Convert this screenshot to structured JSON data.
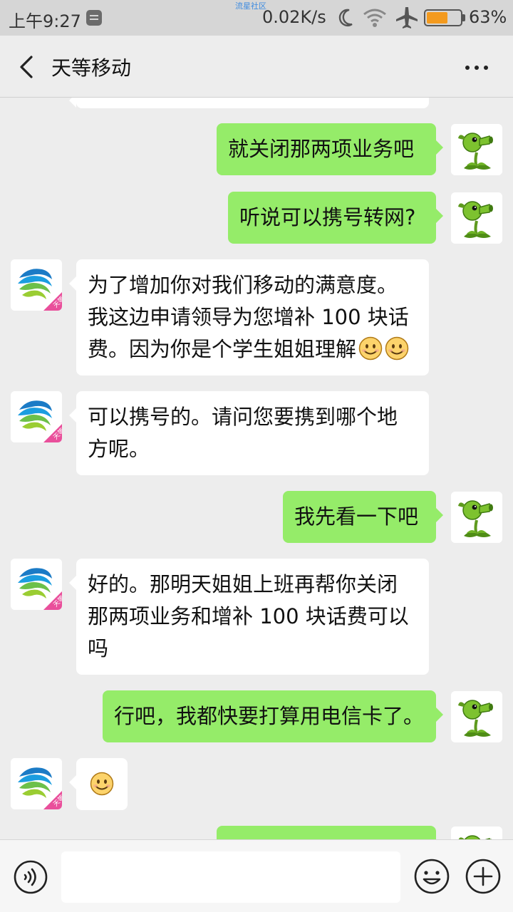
{
  "status_bar": {
    "time": "上午9:27",
    "watermark": "流星社区",
    "network_speed": "0.02K/s",
    "battery": "63%",
    "battery_level": 0.63,
    "icons": [
      "notification-icon",
      "moon-icon",
      "wifi-icon",
      "airplane-icon",
      "battery-icon"
    ]
  },
  "header": {
    "title": "天等移动",
    "back_icon": "chevron-left-icon",
    "more_icon": "more-dots-icon"
  },
  "messages": [
    {
      "side": "out",
      "text": "就关闭那两项业务吧",
      "avatar": "peashooter-avatar"
    },
    {
      "side": "out",
      "text": "听说可以携号转网?",
      "avatar": "peashooter-avatar"
    },
    {
      "side": "in",
      "lines": [
        "为了增加你对我们移动的满意度。",
        "我这边申请领导为您增补 100 块话",
        "费。因为你是个学生姐姐理解"
      ],
      "emojis": 2,
      "avatar": "china-mobile-avatar"
    },
    {
      "side": "in",
      "lines": [
        "可以携号的。请问您要携到哪个地",
        "方呢。"
      ],
      "avatar": "china-mobile-avatar"
    },
    {
      "side": "out",
      "text": "我先看一下吧",
      "avatar": "peashooter-avatar"
    },
    {
      "side": "in",
      "lines": [
        "好的。那明天姐姐上班再帮你关闭",
        "那两项业务和增补 100 块话费可以",
        "吗"
      ],
      "avatar": "china-mobile-avatar"
    },
    {
      "side": "out",
      "text": "行吧，我都快要打算用电信卡了。",
      "avatar": "peashooter-avatar"
    },
    {
      "side": "in",
      "emoji_only": true,
      "avatar": "china-mobile-avatar"
    }
  ],
  "avatar_badge": "天等",
  "colors": {
    "out_bubble": "#95ec69",
    "in_bubble": "#ffffff",
    "background": "#ededed",
    "battery": "#f39a1e"
  },
  "input": {
    "value": "",
    "placeholder": ""
  },
  "bottom_icons": [
    "voice-icon",
    "emoji-icon",
    "plus-icon"
  ]
}
